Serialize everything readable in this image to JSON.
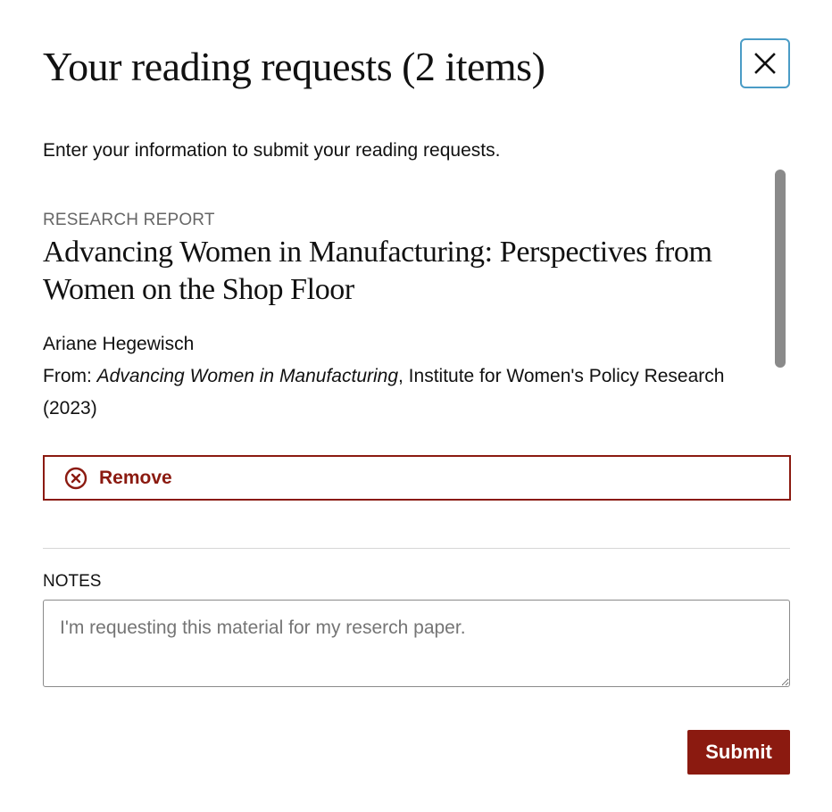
{
  "modal": {
    "title": "Your reading requests (2 items)",
    "close_icon": "close-icon",
    "intro": "Enter your information to submit your reading requests."
  },
  "item": {
    "type": "RESEARCH REPORT",
    "title": "Advancing Women in Manufacturing: Perspectives from Women on the Shop Floor",
    "author": "Ariane Hegewisch",
    "source_prefix": "From: ",
    "source_work": "Advancing Women in Manufacturing",
    "source_rest": ", Institute for Women's Policy Research (2023)",
    "remove_label": "Remove",
    "remove_icon": "circle-x-icon"
  },
  "notes": {
    "label": "NOTES",
    "value": "",
    "placeholder": "I'm requesting this material for my reserch paper."
  },
  "actions": {
    "submit_label": "Submit"
  },
  "colors": {
    "accent": "#8b1a10",
    "focus_ring": "#4a9cc6",
    "scrollbar": "#8a8a8a"
  }
}
